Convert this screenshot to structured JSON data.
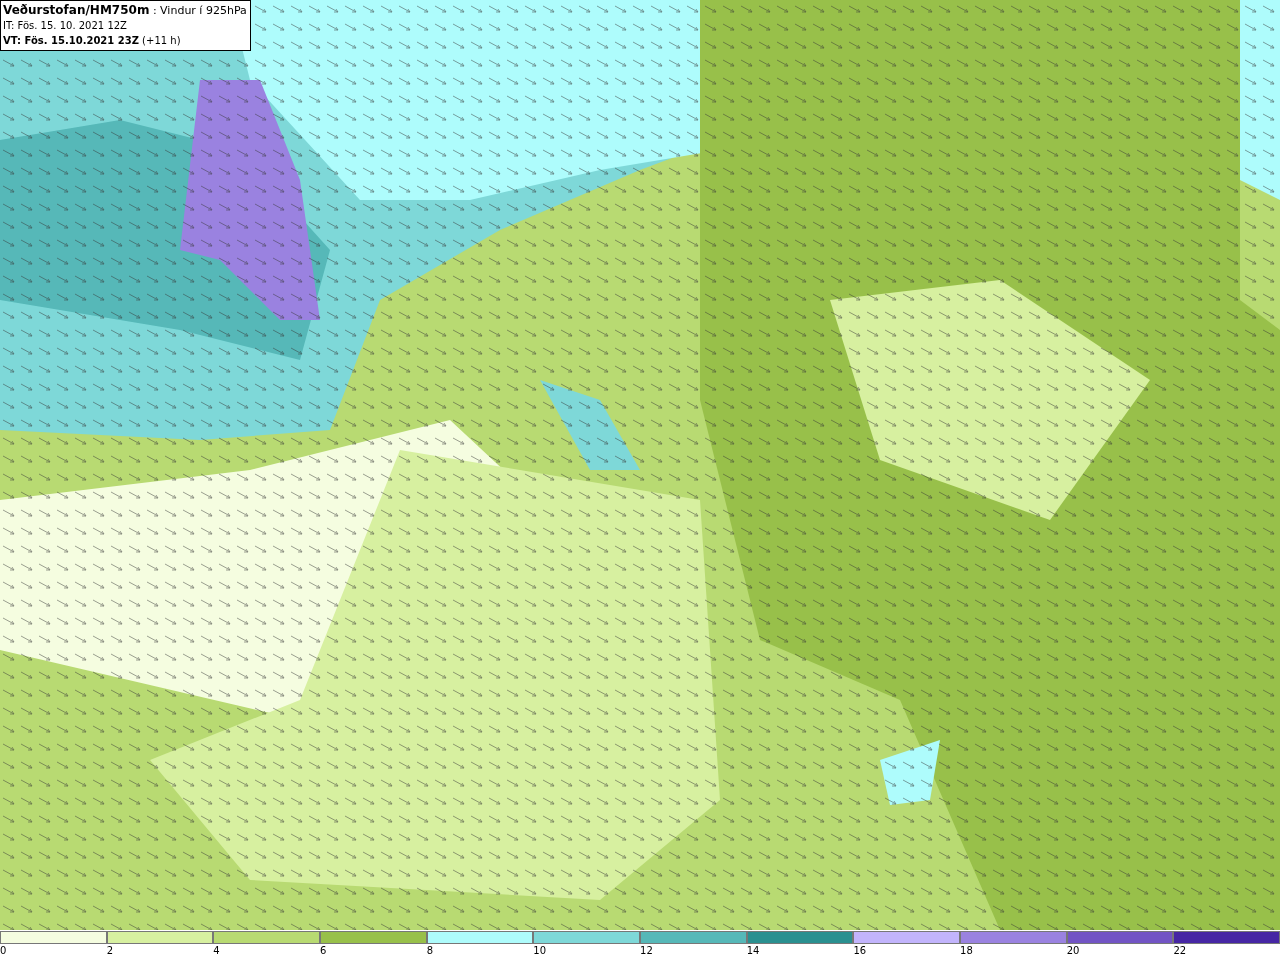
{
  "header": {
    "title": "**Veðurstofan/HM750m** : Vindur í 925hPa",
    "init_time": "IT: Fös. 15. 10. 2021 12Z",
    "valid_time": "**VT: Fös. 15.10.2021 23Z** (+11 h)"
  },
  "legend": [
    {
      "label": "0",
      "color": "#f5fde0"
    },
    {
      "label": "2",
      "color": "#d7f0a0"
    },
    {
      "label": "4",
      "color": "#b8da72"
    },
    {
      "label": "6",
      "color": "#98c04a"
    },
    {
      "label": "8",
      "color": "#aefcfc"
    },
    {
      "label": "10",
      "color": "#7ed8d8"
    },
    {
      "label": "12",
      "color": "#56b8b8"
    },
    {
      "label": "14",
      "color": "#2a9090"
    },
    {
      "label": "16",
      "color": "#c2b4fc"
    },
    {
      "label": "18",
      "color": "#9a82e0"
    },
    {
      "label": "20",
      "color": "#7254c4"
    },
    {
      "label": "22",
      "color": "#4626a4"
    }
  ]
}
